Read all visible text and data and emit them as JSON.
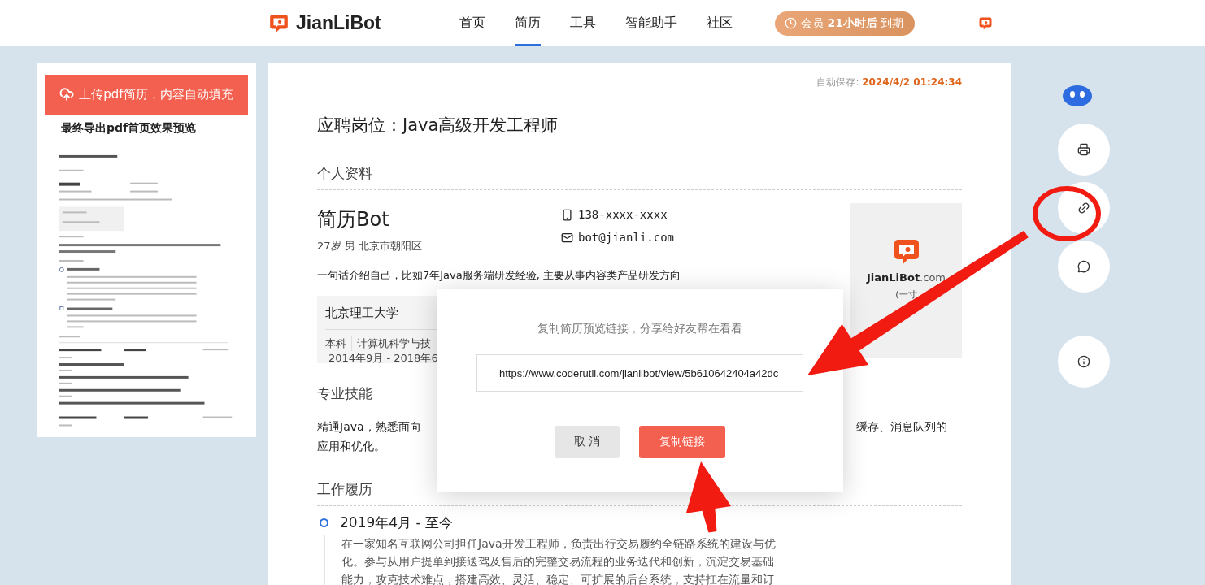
{
  "header": {
    "logo": "JianLiBot",
    "nav": [
      {
        "label": "首页",
        "selected": false
      },
      {
        "label": "简历",
        "selected": true
      },
      {
        "label": "工具",
        "selected": false
      },
      {
        "label": "智能助手",
        "selected": false
      },
      {
        "label": "社区",
        "selected": false
      }
    ],
    "membership": "会员 **21小时后** 到期"
  },
  "left_panel": {
    "upload_button": "上传pdf简历，内容自动填充",
    "preview_title": "最终导出pdf首页效果预览"
  },
  "resume": {
    "autosave_label": "自动保存:",
    "autosave_time": "2024/4/2 01:24:34",
    "position": "应聘岗位：Java高级开发工程师",
    "profile": {
      "heading": "个人资料",
      "name": "简历Bot",
      "details": "27岁 男 北京市朝阳区",
      "phone": "138-xxxx-xxxx",
      "email": "bot@jianli.com",
      "intro": "一句话介绍自己，比如7年Java服务端研发经验, 主要从事内容类产品研发方向",
      "photo_brand": "JianLiBot",
      "photo_suffix": ".com",
      "photo_caption": "(一寸"
    },
    "education": {
      "school": "北京理工大学",
      "degree": "本科",
      "major": "计算机科学与技",
      "dates": "2014年9月 - 2018年6"
    },
    "skills": {
      "heading": "专业技能",
      "line_1_start": "精通Java，熟悉面向",
      "line_1_end": "缓存、消息队列的",
      "line_2": "应用和优化。"
    },
    "work": {
      "heading": "工作履历",
      "entries": [
        {
          "period": "2019年4月 - 至今",
          "lines": [
            "在一家知名互联网公司担任Java开发工程师，负责出行交易履约全链路系统的建设与优",
            "化。参与从用户提单到接送驾及售后的完整交易流程的业务迭代和创新，沉淀交易基础",
            "能力，攻克技术难点，搭建高效、灵活、稳定、可扩展的后台系统，支持扛在流量和订"
          ]
        }
      ]
    }
  },
  "dialog": {
    "message": "复制简历预览链接，分享给好友帮在看看",
    "link": "https://www.coderutil.com/jianlibot/view/5b610642404a42dc",
    "buttons": [
      {
        "label": "取 消",
        "kind": "cancel"
      },
      {
        "label": "复制链接",
        "kind": "primary"
      }
    ]
  }
}
